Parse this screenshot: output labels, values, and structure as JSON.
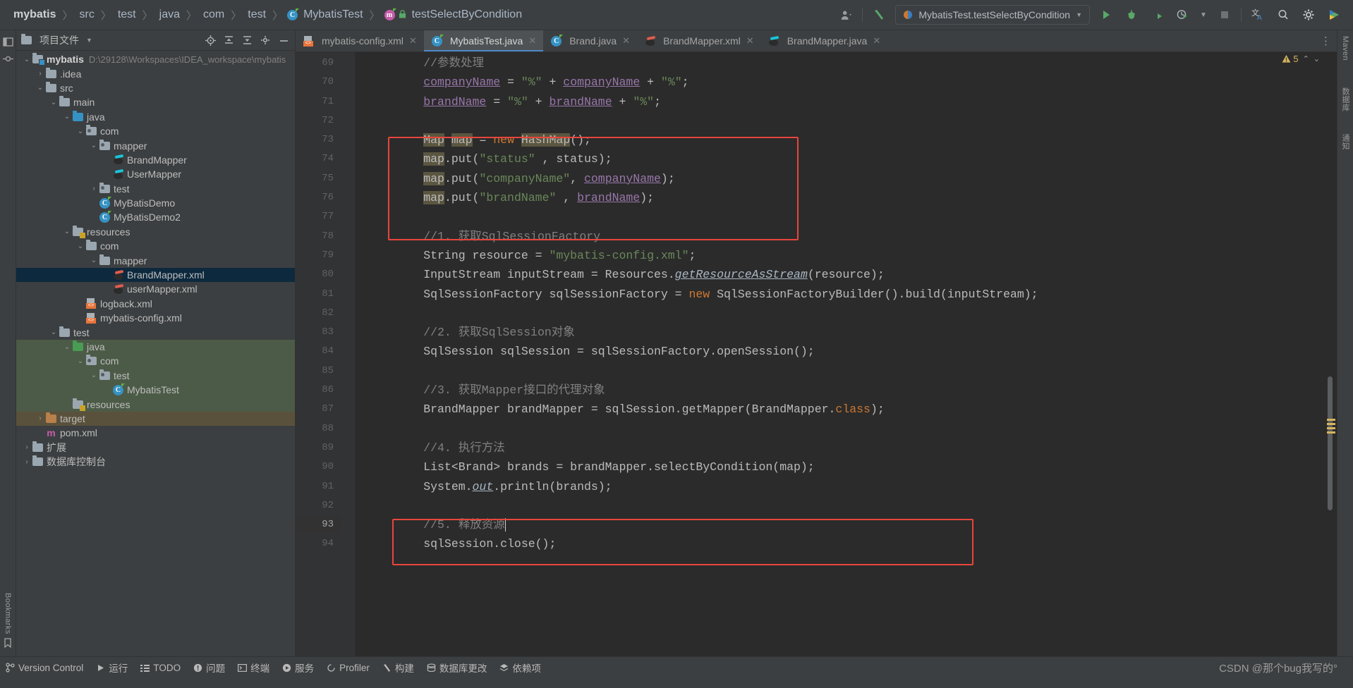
{
  "navbar": {
    "breadcrumbs": [
      {
        "label": "mybatis",
        "bold": true,
        "icon": ""
      },
      {
        "label": "src",
        "bold": false,
        "icon": ""
      },
      {
        "label": "test",
        "bold": false,
        "icon": ""
      },
      {
        "label": "java",
        "bold": false,
        "icon": ""
      },
      {
        "label": "com",
        "bold": false,
        "icon": ""
      },
      {
        "label": "test",
        "bold": false,
        "icon": ""
      },
      {
        "label": "MybatisTest",
        "bold": false,
        "icon": "class-icon"
      },
      {
        "label": "testSelectByCondition",
        "bold": false,
        "icon": "method-icon"
      }
    ],
    "user_icon": "user-account-icon",
    "build_icon": "build-hammer-icon",
    "run_config": "MybatisTest.testSelectByCondition",
    "run_config_icon": "junit-run-icon",
    "actions": [
      {
        "name": "run-button",
        "icon": "play-icon"
      },
      {
        "name": "debug-button",
        "icon": "bug-icon"
      },
      {
        "name": "run-with-coverage-button",
        "icon": "coverage-icon"
      },
      {
        "name": "profiler-button",
        "icon": "profiler-icon"
      },
      {
        "name": "more-run-options",
        "icon": "chevron-down-icon"
      },
      {
        "name": "stop-button",
        "icon": "stop-square-icon"
      },
      {
        "name": "translate-button",
        "icon": "translate-icon"
      },
      {
        "name": "search-everywhere-button",
        "icon": "search-icon"
      },
      {
        "name": "settings-button",
        "icon": "gear-icon"
      },
      {
        "name": "ide-helper-button",
        "icon": "colored-play-icon"
      }
    ]
  },
  "project": {
    "title": "项目文件",
    "header_icons": [
      {
        "name": "select-opened-file-icon",
        "glyph": "target-icon"
      },
      {
        "name": "expand-all-icon",
        "glyph": "expand-icon"
      },
      {
        "name": "collapse-all-icon",
        "glyph": "collapse-icon"
      },
      {
        "name": "project-settings-icon",
        "glyph": "gear-icon"
      },
      {
        "name": "hide-panel-icon",
        "glyph": "minus-icon"
      }
    ],
    "tree": [
      {
        "depth": 0,
        "arrow": "down",
        "icon": "module-folder",
        "label": "mybatis",
        "bold": true,
        "path": "D:\\29128\\Workspaces\\IDEA_workspace\\mybatis"
      },
      {
        "depth": 1,
        "arrow": "right",
        "icon": "folder",
        "label": ".idea"
      },
      {
        "depth": 1,
        "arrow": "down",
        "icon": "folder",
        "label": "src"
      },
      {
        "depth": 2,
        "arrow": "down",
        "icon": "folder",
        "label": "main"
      },
      {
        "depth": 3,
        "arrow": "down",
        "icon": "folder-blue",
        "label": "java"
      },
      {
        "depth": 4,
        "arrow": "down",
        "icon": "package",
        "label": "com"
      },
      {
        "depth": 5,
        "arrow": "down",
        "icon": "package",
        "label": "mapper"
      },
      {
        "depth": 6,
        "arrow": "none",
        "icon": "mapper-java",
        "label": "BrandMapper"
      },
      {
        "depth": 6,
        "arrow": "none",
        "icon": "mapper-java",
        "label": "UserMapper"
      },
      {
        "depth": 5,
        "arrow": "right",
        "icon": "package",
        "label": "test"
      },
      {
        "depth": 5,
        "arrow": "none",
        "icon": "class-run",
        "label": "MyBatisDemo"
      },
      {
        "depth": 5,
        "arrow": "none",
        "icon": "class-run",
        "label": "MyBatisDemo2"
      },
      {
        "depth": 3,
        "arrow": "down",
        "icon": "folder-resources",
        "label": "resources"
      },
      {
        "depth": 4,
        "arrow": "down",
        "icon": "folder",
        "label": "com"
      },
      {
        "depth": 5,
        "arrow": "down",
        "icon": "folder",
        "label": "mapper"
      },
      {
        "depth": 6,
        "arrow": "none",
        "icon": "mapper-xml",
        "label": "BrandMapper.xml",
        "selected": true
      },
      {
        "depth": 6,
        "arrow": "none",
        "icon": "mapper-xml",
        "label": "userMapper.xml"
      },
      {
        "depth": 4,
        "arrow": "none",
        "icon": "xml",
        "label": "logback.xml"
      },
      {
        "depth": 4,
        "arrow": "none",
        "icon": "xml",
        "label": "mybatis-config.xml"
      },
      {
        "depth": 2,
        "arrow": "down",
        "icon": "folder",
        "label": "test"
      },
      {
        "depth": 3,
        "arrow": "down",
        "icon": "folder-green",
        "label": "java",
        "hl": "green"
      },
      {
        "depth": 4,
        "arrow": "down",
        "icon": "package",
        "label": "com",
        "hl": "green"
      },
      {
        "depth": 5,
        "arrow": "down",
        "icon": "package",
        "label": "test",
        "hl": "green"
      },
      {
        "depth": 6,
        "arrow": "none",
        "icon": "class-run",
        "label": "MybatisTest",
        "hl": "green"
      },
      {
        "depth": 3,
        "arrow": "none",
        "icon": "folder-resources",
        "label": "resources",
        "hl": "green"
      },
      {
        "depth": 1,
        "arrow": "right",
        "icon": "folder-orange",
        "label": "target",
        "hl": "orange"
      },
      {
        "depth": 1,
        "arrow": "none",
        "icon": "maven",
        "label": "pom.xml"
      },
      {
        "depth": 0,
        "arrow": "right",
        "icon": "folder",
        "label": "扩展"
      },
      {
        "depth": 0,
        "arrow": "right",
        "icon": "folder",
        "label": "数据库控制台"
      }
    ]
  },
  "editor": {
    "tabs": [
      {
        "label": "mybatis-config.xml",
        "icon": "xml-file-icon",
        "active": false,
        "closable": true
      },
      {
        "label": "MybatisTest.java",
        "icon": "java-class-icon",
        "active": true,
        "closable": true
      },
      {
        "label": "Brand.java",
        "icon": "java-class-icon",
        "active": false,
        "closable": true
      },
      {
        "label": "BrandMapper.xml",
        "icon": "mapper-xml-icon",
        "active": false,
        "closable": true
      },
      {
        "label": "BrandMapper.java",
        "icon": "mapper-java-icon",
        "active": false,
        "closable": true
      }
    ],
    "tab_options_icon": "more-options-icon",
    "warning_count": "5",
    "warning_icon": "warning-triangle-icon",
    "first_line_number": 69,
    "current_line": 93,
    "lines": [
      {
        "n": 69,
        "text": "        //参数处理"
      },
      {
        "n": 70,
        "text": "        companyName = \"%\" + companyName + \"%\";"
      },
      {
        "n": 71,
        "text": "        brandName = \"%\" + brandName + \"%\";"
      },
      {
        "n": 72,
        "text": ""
      },
      {
        "n": 73,
        "text": "        Map map = new HashMap();"
      },
      {
        "n": 74,
        "text": "        map.put(\"status\" , status);"
      },
      {
        "n": 75,
        "text": "        map.put(\"companyName\", companyName);"
      },
      {
        "n": 76,
        "text": "        map.put(\"brandName\" , brandName);"
      },
      {
        "n": 77,
        "text": ""
      },
      {
        "n": 78,
        "text": "        //1. 获取SqlSessionFactory"
      },
      {
        "n": 79,
        "text": "        String resource = \"mybatis-config.xml\";"
      },
      {
        "n": 80,
        "text": "        InputStream inputStream = Resources.getResourceAsStream(resource);"
      },
      {
        "n": 81,
        "text": "        SqlSessionFactory sqlSessionFactory = new SqlSessionFactoryBuilder().build(inputStream);"
      },
      {
        "n": 82,
        "text": ""
      },
      {
        "n": 83,
        "text": "        //2. 获取SqlSession对象"
      },
      {
        "n": 84,
        "text": "        SqlSession sqlSession = sqlSessionFactory.openSession();"
      },
      {
        "n": 85,
        "text": ""
      },
      {
        "n": 86,
        "text": "        //3. 获取Mapper接口的代理对象"
      },
      {
        "n": 87,
        "text": "        BrandMapper brandMapper = sqlSession.getMapper(BrandMapper.class);"
      },
      {
        "n": 88,
        "text": ""
      },
      {
        "n": 89,
        "text": "        //4. 执行方法"
      },
      {
        "n": 90,
        "text": "        List<Brand> brands = brandMapper.selectByCondition(map);"
      },
      {
        "n": 91,
        "text": "        System.out.println(brands);"
      },
      {
        "n": 92,
        "text": ""
      },
      {
        "n": 93,
        "text": "        //5. 释放资源"
      },
      {
        "n": 94,
        "text": "        sqlSession.close();"
      }
    ]
  },
  "status_bar": {
    "items": [
      {
        "label": "Version Control",
        "icon": "branch-icon"
      },
      {
        "label": "运行",
        "icon": "play-icon"
      },
      {
        "label": "TODO",
        "icon": "list-icon"
      },
      {
        "label": "问题",
        "icon": "exclamation-icon"
      },
      {
        "label": "终端",
        "icon": "terminal-icon"
      },
      {
        "label": "服务",
        "icon": "services-icon"
      },
      {
        "label": "Profiler",
        "icon": "profiler-icon"
      },
      {
        "label": "构建",
        "icon": "hammer-icon"
      },
      {
        "label": "数据库更改",
        "icon": "database-changes-icon"
      },
      {
        "label": "依赖项",
        "icon": "dependencies-icon"
      }
    ],
    "watermark": "CSDN @那个bug我写的°"
  },
  "left_rail": {
    "items": [
      {
        "label": "项目",
        "icon": "project-tool-icon"
      },
      {
        "label": "提交",
        "icon": "commit-tool-icon"
      },
      {
        "label": "Bookmarks",
        "icon": "bookmarks-icon"
      }
    ]
  },
  "right_rail": {
    "items": [
      {
        "label": "Maven",
        "icon": "maven-tool-icon"
      },
      {
        "label": "数据库",
        "icon": "database-tool-icon"
      },
      {
        "label": "通知",
        "icon": "notifications-icon"
      }
    ]
  },
  "colors": {
    "accent": "#4a88c7",
    "annotation_red": "#e8453c",
    "selection_blue": "#0d293e",
    "test_green": "#4c5b47",
    "target_orange": "#5a513c",
    "editor_bg": "#2b2b2b",
    "panel_bg": "#3c3f41"
  }
}
